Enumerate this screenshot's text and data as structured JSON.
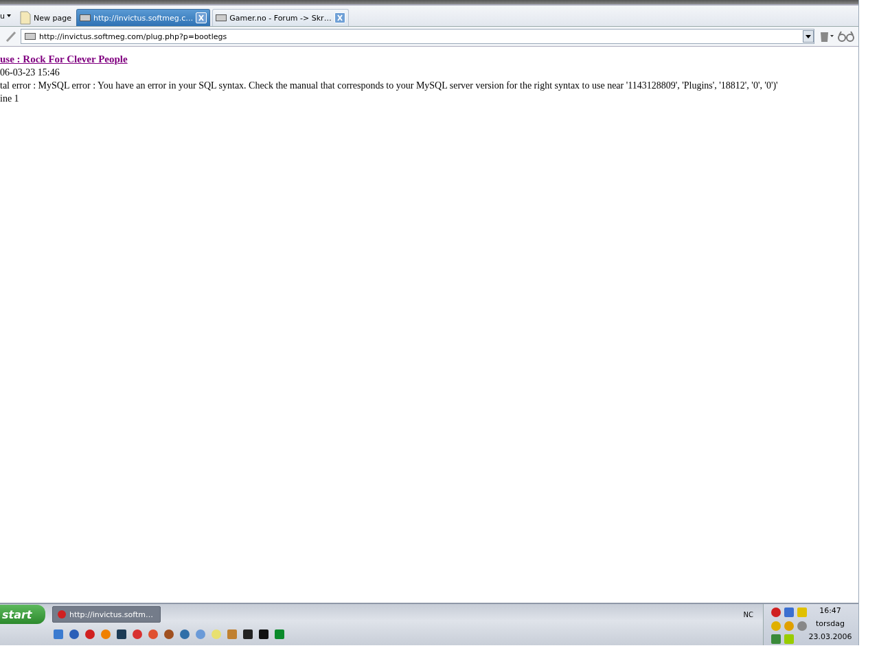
{
  "menu": {
    "label": "u"
  },
  "tabs": [
    {
      "kind": "new",
      "label": "New page",
      "selected": false
    },
    {
      "kind": "page",
      "label": "http://invictus.softmeg.c…",
      "selected": true
    },
    {
      "kind": "page",
      "label": "Gamer.no - Forum -> Skr…",
      "selected": false
    }
  ],
  "address_bar": {
    "value": "http://invictus.softmeg.com/plug.php?p=bootlegs"
  },
  "content": {
    "title": "use : Rock For Clever People",
    "date": "06-03-23 15:46",
    "error": "tal error : MySQL error : You have an error in your SQL syntax. Check the manual that corresponds to your MySQL server version for the right syntax to use near '1143128809', 'Plugins', '18812', '0', '0')'",
    "line": "ine 1"
  },
  "taskbar": {
    "start": "start",
    "tasks": [
      {
        "label": "http://invictus.softm…",
        "selected": false
      }
    ],
    "language": "NC",
    "clock": {
      "time": "16:47",
      "day": "torsdag",
      "date": "23.03.2006"
    }
  }
}
